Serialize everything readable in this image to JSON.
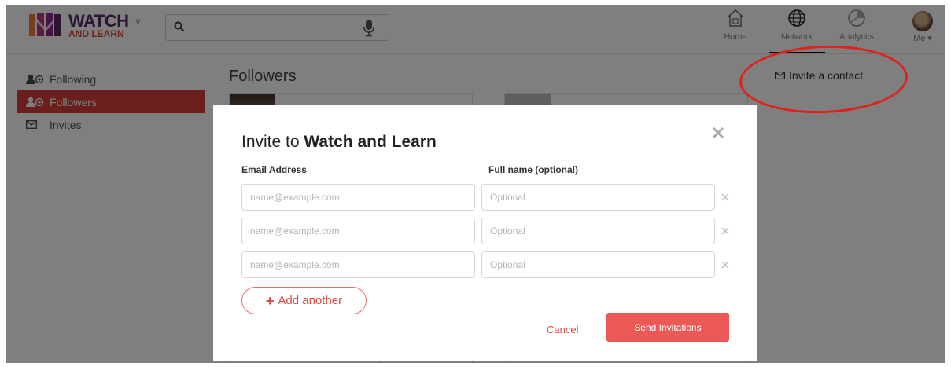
{
  "header": {
    "logo": {
      "line1": "WATCH",
      "line2": "AND LEARN"
    },
    "search": {
      "placeholder": ""
    },
    "nav": [
      {
        "label": "Home",
        "icon": "home-icon"
      },
      {
        "label": "Network",
        "icon": "globe-icon"
      },
      {
        "label": "Analytics",
        "icon": "pie-chart-icon"
      },
      {
        "label": "Me ▾",
        "icon": "avatar"
      }
    ]
  },
  "sidebar": {
    "items": [
      {
        "label": "Following",
        "icon": "user-follow-icon"
      },
      {
        "label": "Followers",
        "icon": "user-follow-icon",
        "active": true
      },
      {
        "label": "Invites",
        "icon": "envelope-icon"
      }
    ]
  },
  "main": {
    "title": "Followers"
  },
  "invite_contact": {
    "label": "Invite a contact"
  },
  "modal": {
    "title_prefix": "Invite to ",
    "title_bold": "Watch and Learn",
    "email_header": "Email Address",
    "name_header": "Full name (optional)",
    "rows": [
      {
        "email_placeholder": "name@example.com",
        "name_placeholder": "Optional"
      },
      {
        "email_placeholder": "name@example.com",
        "name_placeholder": "Optional"
      },
      {
        "email_placeholder": "name@example.com",
        "name_placeholder": "Optional"
      }
    ],
    "add_another": "Add another",
    "cancel": "Cancel",
    "send": "Send Invitations"
  },
  "colors": {
    "brand_red": "#e0473f",
    "sidebar_active": "#d43f3a",
    "send_button": "#ec5856",
    "annotation_red": "#e0211b"
  }
}
